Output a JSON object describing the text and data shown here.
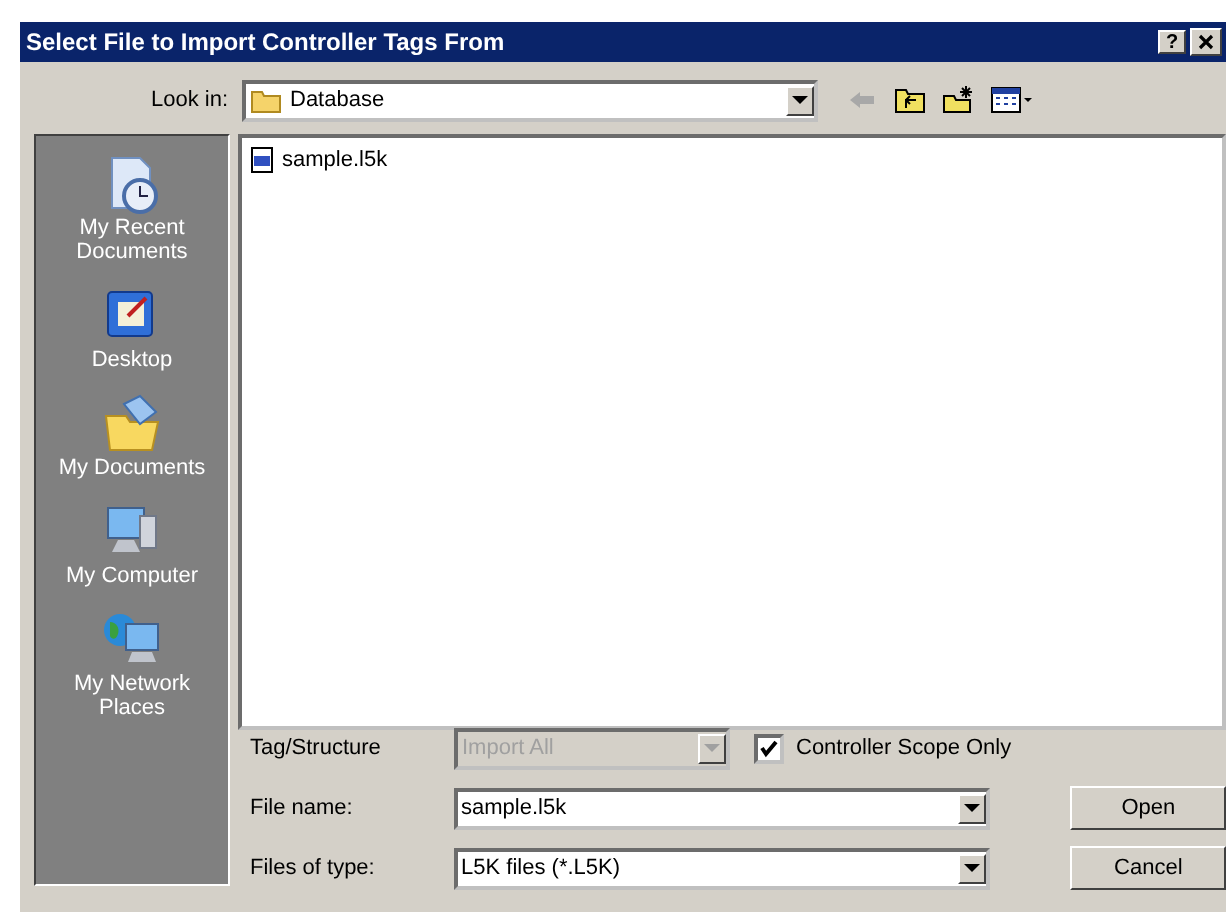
{
  "window": {
    "title": "Select File to Import Controller Tags From",
    "help_button": "?"
  },
  "look_in": {
    "label": "Look in:",
    "value": "Database"
  },
  "places": [
    {
      "label": "My Recent Documents",
      "kind": "recent"
    },
    {
      "label": "Desktop",
      "kind": "desktop"
    },
    {
      "label": "My Documents",
      "kind": "documents"
    },
    {
      "label": "My Computer",
      "kind": "computer"
    },
    {
      "label": "My Network Places",
      "kind": "network"
    }
  ],
  "files": [
    {
      "name": "sample.l5k"
    }
  ],
  "tag_structure": {
    "label": "Tag/Structure",
    "value": "Import All",
    "disabled": true
  },
  "controller_scope": {
    "label": "Controller Scope Only",
    "checked": true
  },
  "file_name": {
    "label": "File name:",
    "value": "sample.l5k"
  },
  "file_type": {
    "label": "Files of type:",
    "value": "L5K files (*.L5K)"
  },
  "buttons": [
    "Open",
    "Cancel"
  ]
}
